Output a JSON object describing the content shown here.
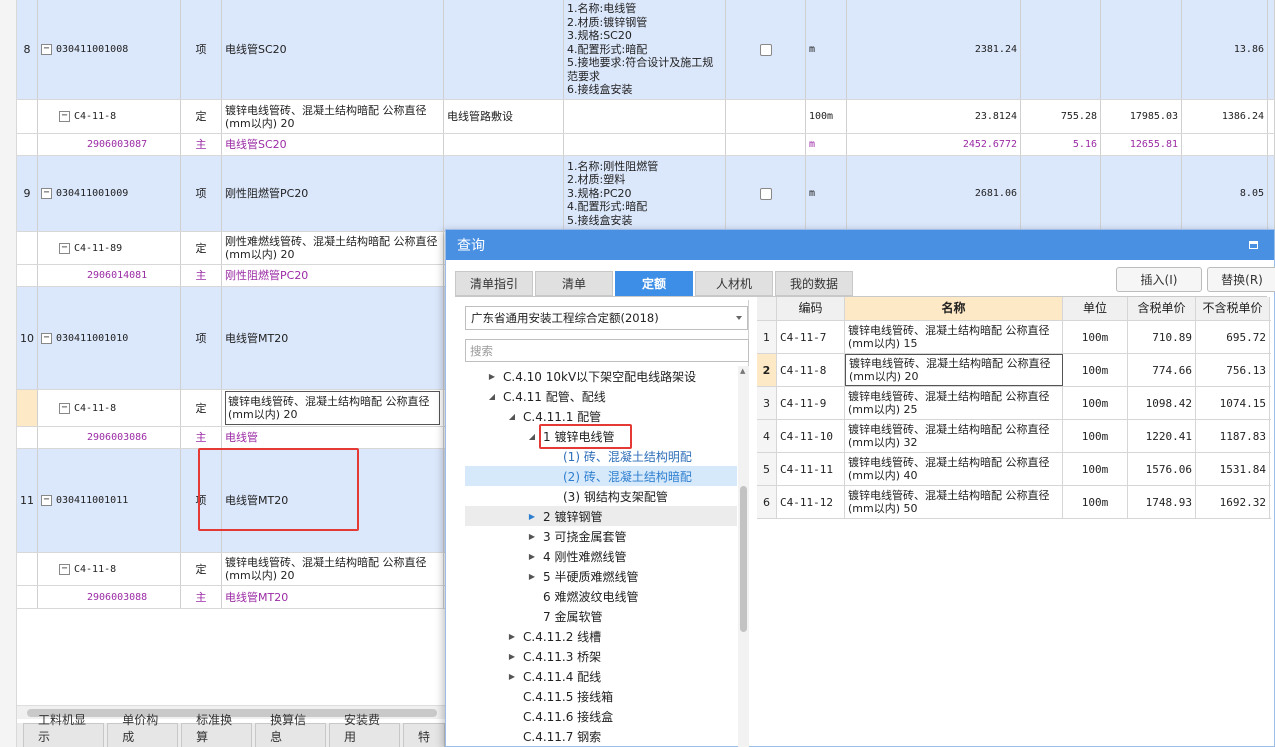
{
  "main_rows": [
    {
      "kind": "xiang",
      "num": "8",
      "code": "030411001008",
      "type": "项",
      "name": "电线管SC20",
      "features": "1.名称:电线管\n2.材质:镀锌钢管\n3.规格:SC20\n4.配置形式:暗配\n5.接地要求:符合设计及施工规范要求\n6.接线盒安装",
      "unit": "m",
      "qty": "2381.24",
      "p3": "13.86"
    },
    {
      "kind": "ding",
      "code": "C4-11-8",
      "type": "定",
      "name": "镀锌电线管砖、混凝土结构暗配 公称直径(mm以内) 20",
      "desc": "电线管路敷设",
      "unit": "100m",
      "qty": "23.8124",
      "p1": "755.28",
      "p2": "17985.03",
      "p3": "1386.24"
    },
    {
      "kind": "zhu",
      "code": "2906003087",
      "type": "主",
      "name": "电线管SC20",
      "unit": "m",
      "qty": "2452.6772",
      "p1": "5.16",
      "p2": "12655.81"
    },
    {
      "kind": "xiang",
      "num": "9",
      "code": "030411001009",
      "type": "项",
      "name": "刚性阻燃管PC20",
      "features": "1.名称:刚性阻燃管\n2.材质:塑料\n3.规格:PC20\n4.配置形式:暗配\n5.接线盒安装",
      "unit": "m",
      "qty": "2681.06",
      "p3": "8.05"
    },
    {
      "kind": "ding",
      "code": "C4-11-89",
      "type": "定",
      "name": "刚性难燃线管砖、混凝土结构暗配 公称直径(mm以内) 20",
      "desc": "电",
      "unit": "",
      "qty": ""
    },
    {
      "kind": "zhu",
      "code": "2906014081",
      "type": "主",
      "name": "刚性阻燃管PC20"
    },
    {
      "kind": "xiang",
      "num": "10",
      "code": "030411001010",
      "type": "项",
      "name": "电线管MT20"
    },
    {
      "kind": "ding",
      "code": "C4-11-8",
      "type": "定",
      "name": "镀锌电线管砖、混凝土结构暗配 公称直径(mm以内) 20",
      "desc": "电"
    },
    {
      "kind": "zhu",
      "code": "2906003086",
      "type": "主",
      "name": "电线管"
    },
    {
      "kind": "xiang",
      "num": "11",
      "code": "030411001011",
      "type": "项",
      "name": "电线管MT20"
    },
    {
      "kind": "ding",
      "code": "C4-11-8",
      "type": "定",
      "name": "镀锌电线管砖、混凝土结构暗配 公称直径(mm以内) 20",
      "desc": "电"
    },
    {
      "kind": "zhu",
      "code": "2906003088",
      "type": "主",
      "name": "电线管MT20"
    }
  ],
  "bottom_tabs": [
    "工料机显示",
    "单价构成",
    "标准换算",
    "换算信息",
    "安装费用",
    "特"
  ],
  "dialog": {
    "title": "查询",
    "tabs": [
      "清单指引",
      "清单",
      "定额",
      "人材机",
      "我的数据"
    ],
    "active_tab": "定额",
    "insert_button": "插入(I)",
    "replace_button": "替换(R)",
    "quota_library": "广东省通用安装工程综合定额(2018)",
    "search_placeholder": "搜索",
    "tree": [
      {
        "label": "C.4.10 10kV以下架空配电线路架设",
        "caret": "▶"
      },
      {
        "label": "C.4.11 配管、配线",
        "caret": "◢"
      },
      {
        "label": "C.4.11.1 配管",
        "caret": "◢"
      },
      {
        "label": "1 镀锌电线管",
        "caret": "◢"
      },
      {
        "label": "(1) 砖、混凝土结构明配",
        "caret": ""
      },
      {
        "label": "(2) 砖、混凝土结构暗配",
        "caret": ""
      },
      {
        "label": "(3) 钢结构支架配管",
        "caret": ""
      },
      {
        "label": "2 镀锌钢管",
        "caret": "▶"
      },
      {
        "label": "3 可挠金属套管",
        "caret": "▶"
      },
      {
        "label": "4 刚性难燃线管",
        "caret": "▶"
      },
      {
        "label": "5 半硬质难燃线管",
        "caret": "▶"
      },
      {
        "label": "6 难燃波纹电线管",
        "caret": ""
      },
      {
        "label": "7 金属软管",
        "caret": ""
      },
      {
        "label": "C.4.11.2 线槽",
        "caret": "▶"
      },
      {
        "label": "C.4.11.3 桥架",
        "caret": "▶"
      },
      {
        "label": "C.4.11.4 配线",
        "caret": "▶"
      },
      {
        "label": "C.4.11.5 接线箱",
        "caret": ""
      },
      {
        "label": "C.4.11.6 接线盒",
        "caret": ""
      },
      {
        "label": "C.4.11.7 钢索",
        "caret": ""
      }
    ],
    "grid_headers": [
      "",
      "编码",
      "名称",
      "单位",
      "含税单价",
      "不含税单价"
    ],
    "grid_rows": [
      {
        "idx": "1",
        "code": "C4-11-7",
        "name": "镀锌电线管砖、混凝土结构暗配 公称直径(mm以内) 15",
        "unit": "100m",
        "p1": "710.89",
        "p2": "695.72"
      },
      {
        "idx": "2",
        "code": "C4-11-8",
        "name": "镀锌电线管砖、混凝土结构暗配 公称直径(mm以内) 20",
        "unit": "100m",
        "p1": "774.66",
        "p2": "756.13"
      },
      {
        "idx": "3",
        "code": "C4-11-9",
        "name": "镀锌电线管砖、混凝土结构暗配 公称直径(mm以内) 25",
        "unit": "100m",
        "p1": "1098.42",
        "p2": "1074.15"
      },
      {
        "idx": "4",
        "code": "C4-11-10",
        "name": "镀锌电线管砖、混凝土结构暗配 公称直径(mm以内) 32",
        "unit": "100m",
        "p1": "1220.41",
        "p2": "1187.83"
      },
      {
        "idx": "5",
        "code": "C4-11-11",
        "name": "镀锌电线管砖、混凝土结构暗配 公称直径(mm以内) 40",
        "unit": "100m",
        "p1": "1576.06",
        "p2": "1531.84"
      },
      {
        "idx": "6",
        "code": "C4-11-12",
        "name": "镀锌电线管砖、混凝土结构暗配 公称直径(mm以内) 50",
        "unit": "100m",
        "p1": "1748.93",
        "p2": "1692.32"
      }
    ]
  }
}
